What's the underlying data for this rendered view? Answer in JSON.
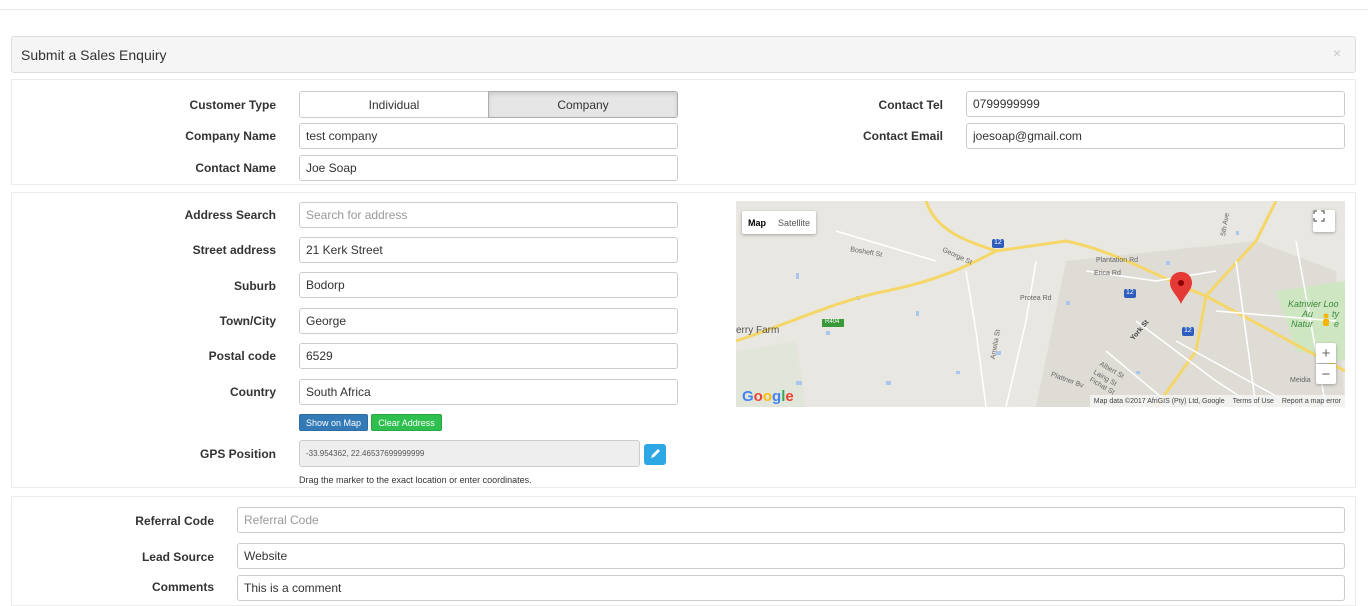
{
  "panel": {
    "title": "Submit a Sales Enquiry",
    "close_glyph": "×"
  },
  "customer": {
    "type_label": "Customer Type",
    "type_options": [
      "Individual",
      "Company"
    ],
    "type_selected": "Company",
    "company_name_label": "Company Name",
    "company_name_value": "test company",
    "contact_name_label": "Contact Name",
    "contact_name_value": "Joe Soap",
    "contact_tel_label": "Contact Tel",
    "contact_tel_value": "0799999999",
    "contact_email_label": "Contact Email",
    "contact_email_value": "joesoap@gmail.com"
  },
  "address": {
    "search_label": "Address Search",
    "search_placeholder": "Search for address",
    "street_label": "Street address",
    "street_value": "21 Kerk Street",
    "suburb_label": "Suburb",
    "suburb_value": "Bodorp",
    "town_label": "Town/City",
    "town_value": "George",
    "postal_label": "Postal code",
    "postal_value": "6529",
    "country_label": "Country",
    "country_value": "South Africa",
    "show_on_map": "Show on Map",
    "clear_address": "Clear Address",
    "gps_label": "GPS Position",
    "gps_value": "-33.954362, 22.46537699999999",
    "gps_help": "Drag the marker to the exact location or enter coordinates.",
    "edit_icon": "pencil-icon"
  },
  "map": {
    "type_map": "Map",
    "type_satellite": "Satellite",
    "attribution": "Map data ©2017 AfriGIS (Pty) Ltd, Google",
    "terms": "Terms of Use",
    "report": "Report a map error",
    "zoom_in": "+",
    "zoom_out": "−",
    "logo": "Google",
    "labels": {
      "farm": "erry Farm",
      "reserve1": "Katrivier Loo",
      "reserve2": "Au",
      "reserve3": "ty",
      "reserve4": "Natur",
      "reserve5": "e",
      "york": "York St",
      "route12": "12",
      "r404": "R404",
      "plantation": "Plantation Rd",
      "erica": "Erica Rd",
      "protea": "Protea Rd",
      "bosheft": "Bosheft St",
      "george": "George St",
      "amelia": "Amelia St",
      "albert": "Albert St",
      "langs": "Laing St",
      "fichat": "Fichat St",
      "plattner": "Plattner Bv",
      "sth": "5th Ave",
      "meidl": "Meidia"
    },
    "marker_color": "#e53935"
  },
  "extra": {
    "referral_label": "Referral Code",
    "referral_placeholder": "Referral Code",
    "lead_label": "Lead Source",
    "lead_value": "Website",
    "comments_label": "Comments",
    "comments_value": "This is a comment"
  }
}
